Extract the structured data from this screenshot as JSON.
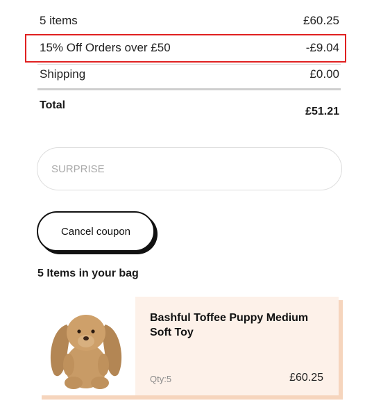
{
  "summary": {
    "items_label": "5 items",
    "items_value": "£60.25",
    "discount_label": "15% Off Orders over £50",
    "discount_value": "-£9.04",
    "shipping_label": "Shipping",
    "shipping_value": "£0.00",
    "total_label": "Total",
    "total_value": "£51.21"
  },
  "coupon": {
    "input_value": "SURPRISE",
    "cancel_label": "Cancel coupon"
  },
  "bag": {
    "title": "5 Items in your bag",
    "items": [
      {
        "title": "Bashful Toffee Puppy Medium Soft Toy",
        "qty": "Qty:5",
        "price": "£60.25"
      }
    ]
  },
  "colors": {
    "highlight_border": "#e02020",
    "card_bg": "#fdf1e9",
    "card_shadow": "#f6d5bd"
  }
}
